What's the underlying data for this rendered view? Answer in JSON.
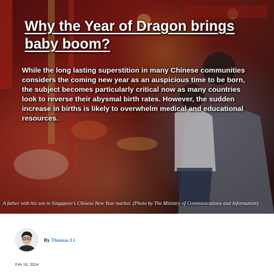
{
  "article": {
    "title": "Why the Year of Dragon brings baby boom?",
    "summary": "While the long lasting superstition in many Chinese communities considers the coming new year as an auspicious time to be born, the subject becomes particularly critical now as many countries look to reverse their abysmal birth rates. However, the sudden increase in births is likely to overwhelm medical and educational resources.",
    "image_caption": "A father with his son in Singapore's Chinese New Year market. (Photo by The Ministry of Communications and Information)",
    "byline_prefix": "By",
    "author_name": "Thomas Li",
    "date": "Feb 18, 2024"
  },
  "colors": {
    "link": "#3a86d8",
    "text": "#222222",
    "hero_overlay_text": "#ffffff"
  }
}
